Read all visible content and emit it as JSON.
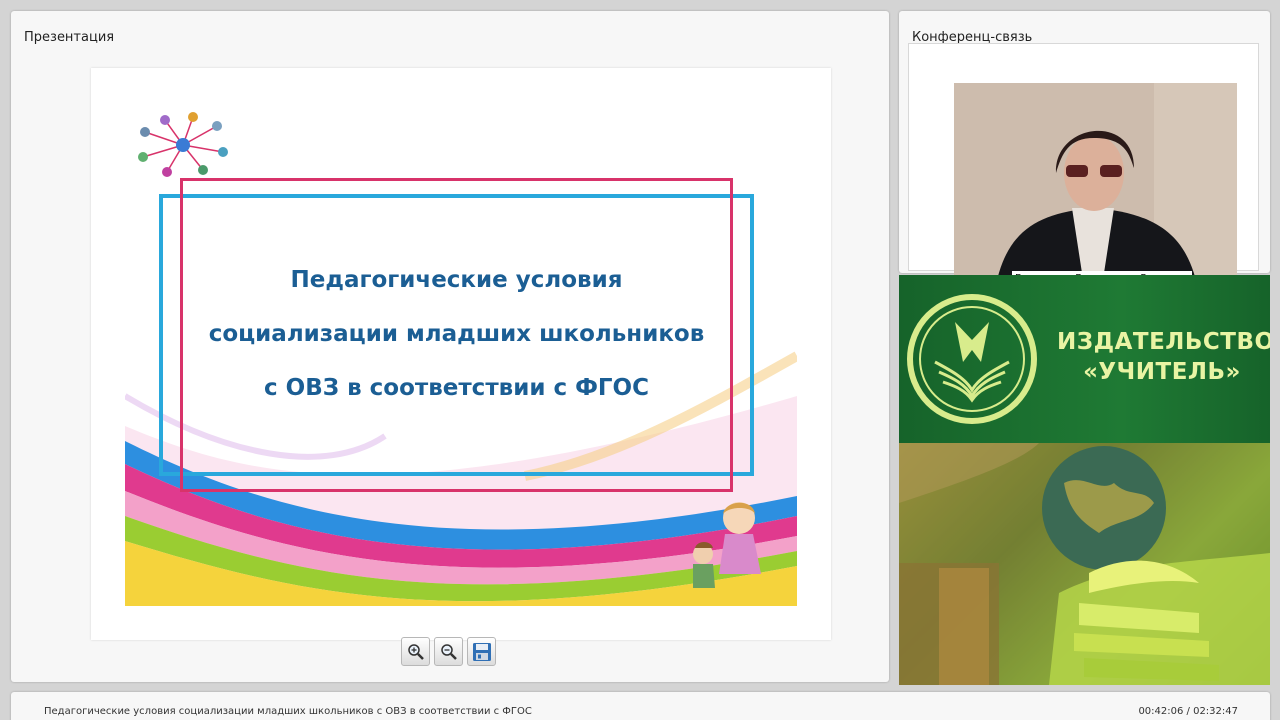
{
  "presentation_panel": {
    "title": "Презентация",
    "slide": {
      "title_lines": [
        "Педагогические условия",
        "социализации младших школьников",
        "с ОВЗ в соответствии с ФГОС"
      ]
    },
    "toolbar": {
      "zoom_in_icon": "zoom-in-icon",
      "zoom_out_icon": "zoom-out-icon",
      "save_icon": "floppy-disk-icon"
    }
  },
  "conference_panel": {
    "title": "Конференц-связь",
    "participant_name": "Валентина Васильевна Русанова"
  },
  "banner": {
    "publisher_line1": "ИЗДАТЕЛЬСТВО",
    "publisher_line2": "«УЧИТЕЛЬ»"
  },
  "bottom_bar": {
    "title": "Педагогические условия социализации младших школьников с ОВЗ в соответствии с ФГОС",
    "time": "00:42:06 / 02:32:47"
  },
  "colors": {
    "slide_title": "#1b5e94",
    "frame_blue": "#29a8dc",
    "frame_pink": "#d8336a",
    "banner_green": "#1b6b2c",
    "banner_text": "#e9f4a4"
  }
}
